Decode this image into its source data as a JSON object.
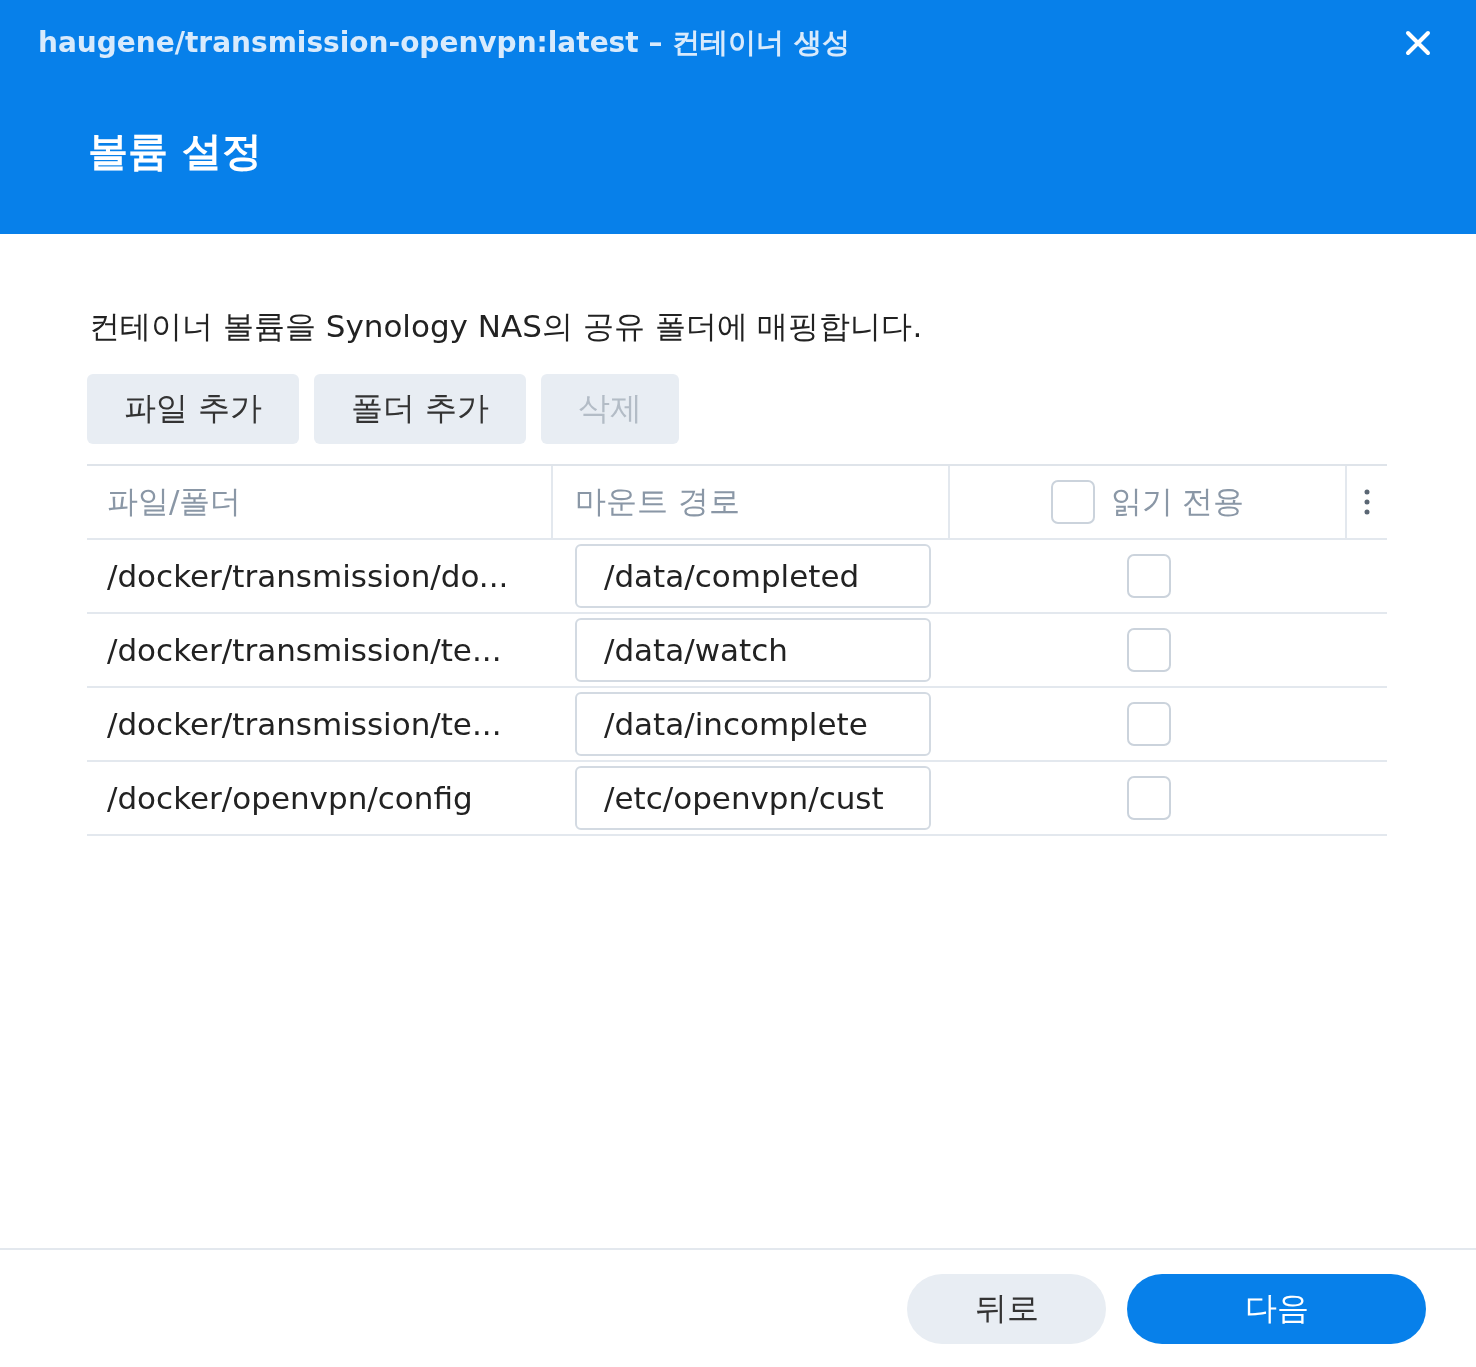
{
  "window": {
    "title": "haugene/transmission-openvpn:latest – 컨테이너 생성"
  },
  "header": {
    "title": "볼륨 설정"
  },
  "description": "컨테이너 볼륨을 Synology NAS의 공유 폴더에 매핑합니다.",
  "toolbar": [
    {
      "label": "파일 추가",
      "disabled": false
    },
    {
      "label": "폴더 추가",
      "disabled": false
    },
    {
      "label": "삭제",
      "disabled": true
    }
  ],
  "table": {
    "columns": [
      {
        "label": "파일/폴더"
      },
      {
        "label": "마운트 경로"
      },
      {
        "label": "읽기 전용",
        "checked": false
      }
    ],
    "rows": [
      {
        "path": "/docker/transmission/do...",
        "mount": "/data/completed",
        "read_only": false
      },
      {
        "path": "/docker/transmission/te...",
        "mount": "/data/watch",
        "read_only": false
      },
      {
        "path": "/docker/transmission/te...",
        "mount": "/data/incomplete",
        "read_only": false
      },
      {
        "path": "/docker/openvpn/config",
        "mount": "/etc/openvpn/cust",
        "read_only": false
      }
    ]
  },
  "footer": [
    {
      "label": "뒤로",
      "kind": "secondary"
    },
    {
      "label": "다음",
      "kind": "primary"
    }
  ]
}
